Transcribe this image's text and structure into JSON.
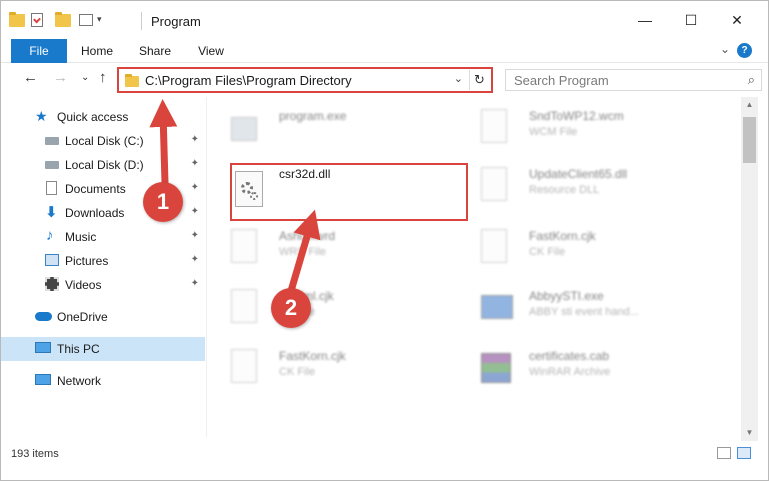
{
  "window": {
    "title": "Program",
    "minimize_glyph": "—",
    "maximize_glyph": "☐",
    "close_glyph": "✕"
  },
  "ribbon": {
    "tabs": [
      "File",
      "Home",
      "Share",
      "View"
    ],
    "help_glyph": "?",
    "collapse_glyph": "⌄"
  },
  "address": {
    "path": "C:\\Program Files\\Program Directory",
    "dropdown_glyph": "⌄",
    "refresh_glyph": "↻"
  },
  "search": {
    "placeholder": "Search Program",
    "icon_glyph": "⌕"
  },
  "nav": {
    "back": "←",
    "forward": "→",
    "recent": "⌄",
    "up": "↑"
  },
  "sidebar": {
    "items": [
      {
        "label": "Quick access",
        "icon": "star-icon"
      },
      {
        "label": "Local Disk (C:)",
        "icon": "drive-icon",
        "pinned": true
      },
      {
        "label": "Local Disk (D:)",
        "icon": "drive-icon",
        "pinned": true
      },
      {
        "label": "Documents",
        "icon": "documents-icon",
        "pinned": true
      },
      {
        "label": "Downloads",
        "icon": "downloads-icon",
        "pinned": true
      },
      {
        "label": "Music",
        "icon": "music-icon",
        "pinned": true
      },
      {
        "label": "Pictures",
        "icon": "pictures-icon",
        "pinned": true
      },
      {
        "label": "Videos",
        "icon": "videos-icon",
        "pinned": true
      },
      {
        "label": "OneDrive",
        "icon": "cloud-icon"
      },
      {
        "label": "This PC",
        "icon": "computer-icon",
        "selected": true
      },
      {
        "label": "Network",
        "icon": "network-icon"
      }
    ],
    "pin_glyph": "📌"
  },
  "files": [
    {
      "name": "program.exe",
      "type": ""
    },
    {
      "name": "SndToWP12.wcm",
      "type": "WCM File"
    },
    {
      "name": "csr32d.dll",
      "type": ""
    },
    {
      "name": "UpdateClient65.dll",
      "type": "Resource DLL"
    },
    {
      "name": "Ashd.xwrd",
      "type": "WRD File"
    },
    {
      "name": "FastKorn.cjk",
      "type": "CK File"
    },
    {
      "name": "Ashtml.cjk",
      "type": "CK File"
    },
    {
      "name": "AbbyySTI.exe",
      "type": "ABBY sti event hand..."
    },
    {
      "name": "FastKorn.cjk",
      "type": "CK File"
    },
    {
      "name": "certificates.cab",
      "type": "WinRAR Archive"
    }
  ],
  "status": {
    "item_count": "193 items"
  },
  "annotations": {
    "step1": "1",
    "step2": "2"
  },
  "colors": {
    "accent": "#1979ca",
    "highlight": "#d9453d",
    "selected": "#cce4f7"
  }
}
